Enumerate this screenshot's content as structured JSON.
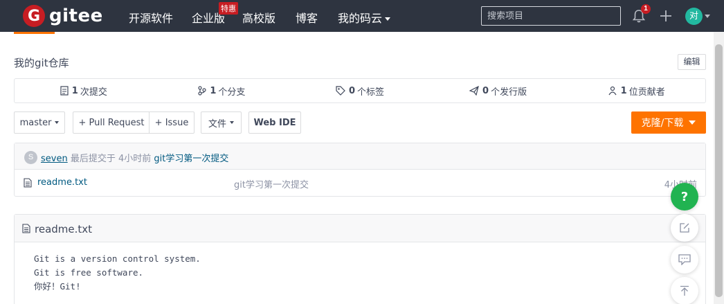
{
  "nav": {
    "logo_letter": "G",
    "logo_text": "gitee",
    "items": [
      "开源软件",
      "企业版",
      "高校版",
      "博客",
      "我的码云"
    ],
    "enterprise_badge": "特惠",
    "search_placeholder": "搜索项目",
    "notification_count": "1",
    "avatar_text": "对"
  },
  "repo": {
    "description": "我的git仓库",
    "edit_label": "编辑"
  },
  "stats": [
    {
      "count": "1",
      "label": "次提交",
      "icon": "commit-icon"
    },
    {
      "count": "1",
      "label": "个分支",
      "icon": "branch-icon"
    },
    {
      "count": "0",
      "label": "个标签",
      "icon": "tag-icon"
    },
    {
      "count": "0",
      "label": "个发行版",
      "icon": "release-icon"
    },
    {
      "count": "1",
      "label": "位贡献者",
      "icon": "contributors-icon"
    }
  ],
  "actions": {
    "branch": "master",
    "pull_request": "+ Pull Request",
    "issue": "+ Issue",
    "file": "文件",
    "web_ide": "Web IDE",
    "clone": "克隆/下载"
  },
  "commit": {
    "avatar_letter": "S",
    "author": "seven",
    "meta": "最后提交于 4小时前",
    "message": "git学习第一次提交"
  },
  "files": [
    {
      "name": "readme.txt",
      "message": "git学习第一次提交",
      "time": "4小时前"
    }
  ],
  "readme": {
    "title": "readme.txt",
    "lines": [
      "Git is a version control system.",
      "Git is free software.",
      "你好！Git!"
    ]
  },
  "floating": {
    "help_label": "?"
  },
  "colors": {
    "nav_bg": "#2e3440",
    "brand_red": "#c71d23",
    "accent_orange": "#fe7300",
    "help_green": "#21b351",
    "link": "#005980"
  }
}
